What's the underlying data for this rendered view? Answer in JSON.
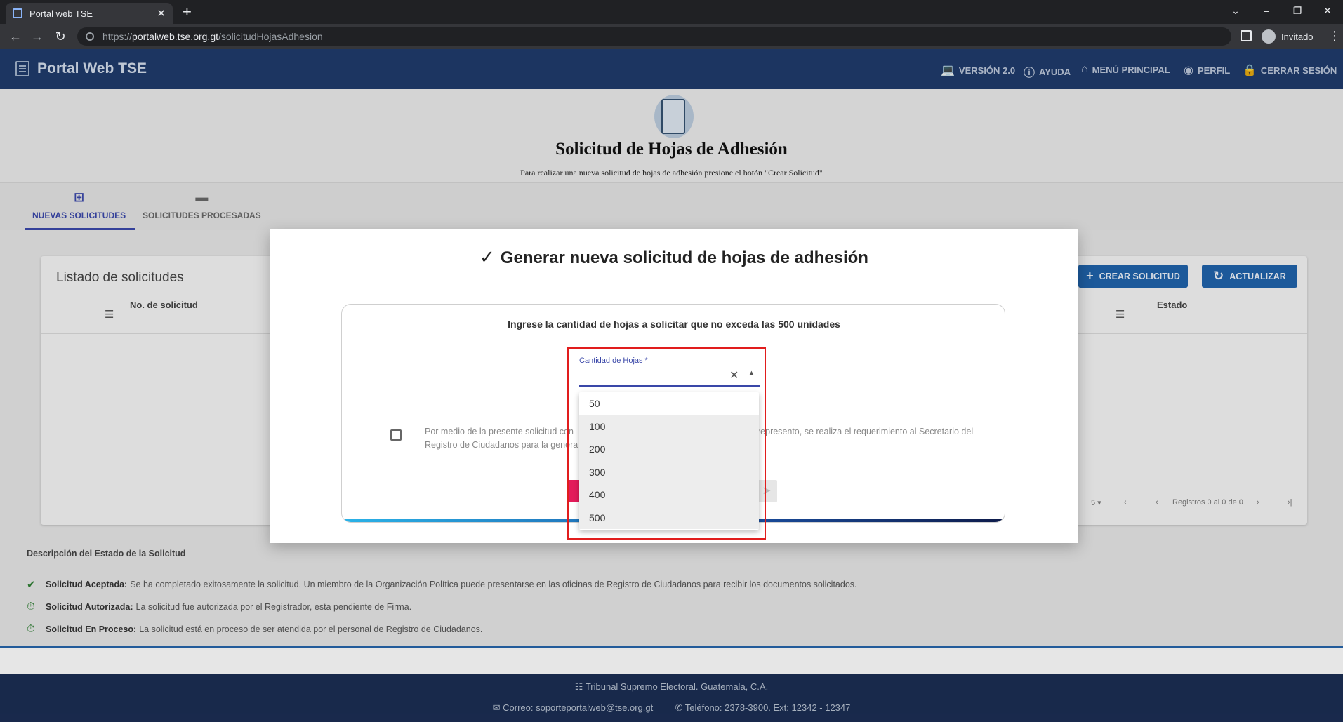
{
  "browser": {
    "tab_title": "Portal web TSE",
    "tab_close": "✕",
    "new_tab": "+",
    "url_scheme": "https://",
    "url_host": "portalweb.tse.org.gt",
    "url_path": "/solicitudHojasAdhesion",
    "profile_label": "Invitado"
  },
  "header": {
    "brand": "Portal Web TSE",
    "nav": [
      {
        "icon": "laptop-icon",
        "label": "VERSIÓN 2.0"
      },
      {
        "icon": "help-icon",
        "label": "AYUDA"
      },
      {
        "icon": "home-icon",
        "label": "MENÚ PRINCIPAL"
      },
      {
        "icon": "account-icon",
        "label": "PERFIL"
      },
      {
        "icon": "lock-icon",
        "label": "CERRAR SESIÓN"
      }
    ]
  },
  "page": {
    "title": "Solicitud de Hojas de Adhesión",
    "subtitle": "Para realizar una nueva solicitud de hojas de adhesión presione el botón \"Crear Solicitud\""
  },
  "tabs": [
    {
      "label": "NUEVAS SOLICITUDES",
      "active": true,
      "icon": "add-box-icon"
    },
    {
      "label": "SOLICITUDES PROCESADAS",
      "active": false,
      "icon": "folder-icon"
    }
  ],
  "listing": {
    "title": "Listado de solicitudes",
    "columns": [
      "No. de solicitud",
      "Estado"
    ],
    "create_button": "CREAR SOLICITUD",
    "refresh_button": "ACTUALIZAR",
    "page_size": "5",
    "records_text": "Registros 0 al 0 de 0"
  },
  "legend": {
    "title": "Descripción del Estado de la Solicitud",
    "items": [
      {
        "name": "Solicitud Aceptada:",
        "desc": "Se ha completado exitosamente la solicitud. Un miembro de la Organización Política puede presentarse en las oficinas de Registro de Ciudadanos para recibir los documentos solicitados.",
        "icon": "check-icon",
        "color": "#2e7d32"
      },
      {
        "name": "Solicitud Autorizada:",
        "desc": "La solicitud fue autorizada por el Registrador, esta pendiente de Firma.",
        "icon": "timer-icon",
        "color": "#2e7d32"
      },
      {
        "name": "Solicitud En Proceso:",
        "desc": "La solicitud está en proceso de ser atendida por el personal de Registro de Ciudadanos.",
        "icon": "timer-icon",
        "color": "#2e7d32"
      }
    ]
  },
  "footer": {
    "org": "Tribunal Supremo Electoral. Guatemala, C.A.",
    "email": "Correo: soporteportalweb@tse.org.gt",
    "phone": "Teléfono: 2378-3900. Ext: 12342 - 12347"
  },
  "modal": {
    "title": "Generar nueva solicitud de hojas de adhesión",
    "instruction": "Ingrese la cantidad de hojas a solicitar que no exceda las 500 unidades",
    "terms_left": "Por medio de la presente solicitud con Registro de Ciudadanos para la genera",
    "terms_right": "represento, se realiza el requerimiento al Secretario del",
    "field_label": "Cantidad de Hojas *",
    "field_value": "",
    "options": [
      "50",
      "100",
      "200",
      "300",
      "400",
      "500"
    ],
    "highlighted_options": [
      "100",
      "200",
      "300",
      "400",
      "500"
    ]
  },
  "colors": {
    "header_bg": "#1f3a6a",
    "primary": "#3a47a8",
    "button_blue": "#1f61a8",
    "footer_bg": "#1b2d52",
    "accent_red": "#e31b5a",
    "annotation_red": "#e11d1d"
  }
}
